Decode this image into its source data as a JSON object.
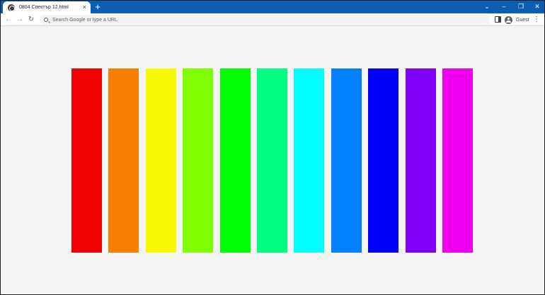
{
  "browser": {
    "tab": {
      "title": "0804 Спектър 12.html",
      "close_glyph": "×"
    },
    "new_tab_glyph": "+",
    "window_controls": {
      "tab_search": "⌄",
      "minimize": "–",
      "restore": "❐",
      "close": "✕"
    },
    "nav": {
      "back": "←",
      "forward": "→",
      "reload": "↻"
    },
    "omnibox": {
      "placeholder": "Search Google or type a URL"
    },
    "profile": {
      "label": "Guest"
    },
    "menu_glyph": "⋮",
    "accent_color": "#0a5fb4"
  },
  "page": {
    "background": "#f4f4f4",
    "bars": [
      {
        "color": "#f00000"
      },
      {
        "color": "#f88000"
      },
      {
        "color": "#f8f800"
      },
      {
        "color": "#80ff00"
      },
      {
        "color": "#00ff00"
      },
      {
        "color": "#00ff80"
      },
      {
        "color": "#00ffff"
      },
      {
        "color": "#0080ff"
      },
      {
        "color": "#0000f8"
      },
      {
        "color": "#8000f8"
      },
      {
        "color": "#f000f0"
      }
    ]
  }
}
